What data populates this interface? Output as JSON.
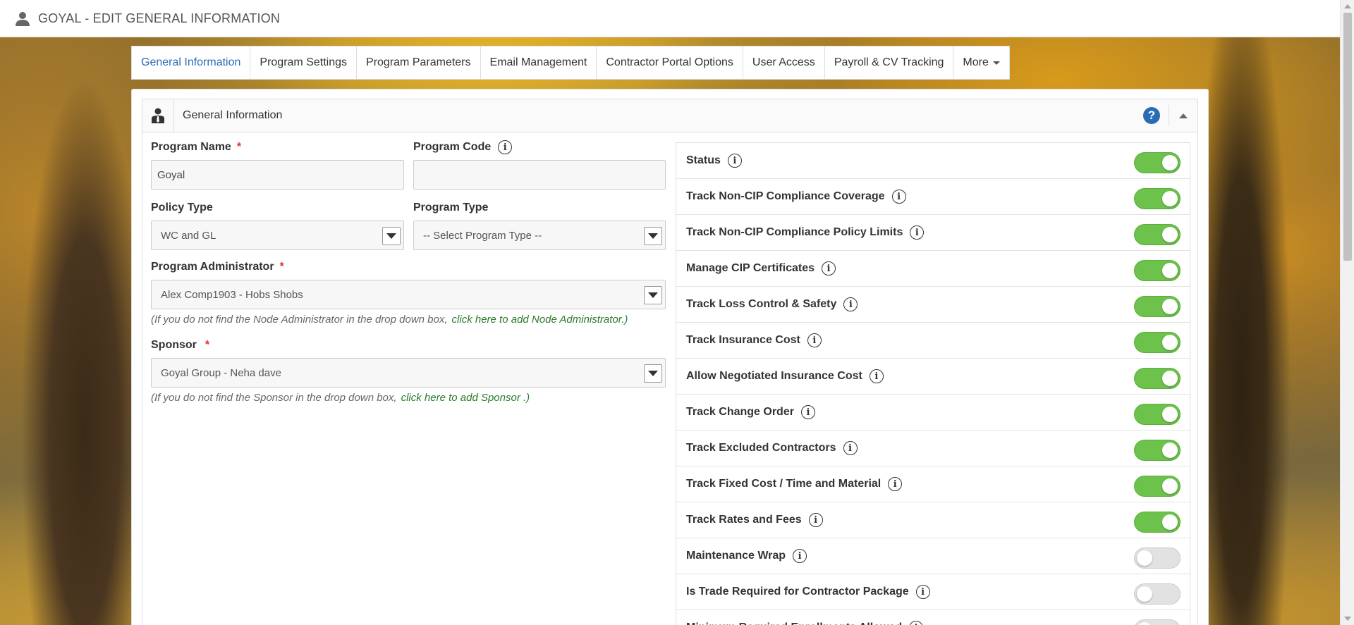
{
  "header": {
    "title": "GOYAL - EDIT GENERAL INFORMATION"
  },
  "tabs": [
    {
      "label": "General Information",
      "active": true
    },
    {
      "label": "Program Settings"
    },
    {
      "label": "Program Parameters"
    },
    {
      "label": "Email Management"
    },
    {
      "label": "Contractor Portal Options"
    },
    {
      "label": "User Access"
    },
    {
      "label": "Payroll & CV Tracking"
    },
    {
      "label": "More"
    }
  ],
  "panel": {
    "title": "General Information",
    "help": "?"
  },
  "form": {
    "program_name": {
      "label": "Program Name",
      "required": "*",
      "value": "Goyal"
    },
    "program_code": {
      "label": "Program Code",
      "value": ""
    },
    "policy_type": {
      "label": "Policy Type",
      "value": "WC and GL"
    },
    "program_type": {
      "label": "Program Type",
      "value": "-- Select Program Type --"
    },
    "program_admin": {
      "label": "Program Administrator",
      "required": "*",
      "value": "Alex Comp1903 - Hobs Shobs",
      "hint": "(If you do not find the Node Administrator in the drop down box,",
      "hint_link": "click here to add Node Administrator.)"
    },
    "sponsor": {
      "label": "Sponsor",
      "required": "*",
      "value": "Goyal Group - Neha dave",
      "hint": "(If you do not find the Sponsor in the drop down box,",
      "hint_link": "click here to add Sponsor .)"
    }
  },
  "toggles": [
    {
      "label": "Status",
      "on": true
    },
    {
      "label": "Track Non-CIP Compliance Coverage",
      "on": true
    },
    {
      "label": "Track Non-CIP Compliance Policy Limits",
      "on": true
    },
    {
      "label": "Manage CIP Certificates",
      "on": true
    },
    {
      "label": "Track Loss Control & Safety",
      "on": true
    },
    {
      "label": "Track Insurance Cost",
      "on": true
    },
    {
      "label": "Allow Negotiated Insurance Cost",
      "on": true
    },
    {
      "label": "Track Change Order",
      "on": true
    },
    {
      "label": "Track Excluded Contractors",
      "on": true
    },
    {
      "label": "Track Fixed Cost / Time and Material",
      "on": true
    },
    {
      "label": "Track Rates and Fees",
      "on": true
    },
    {
      "label": "Maintenance Wrap",
      "on": false
    },
    {
      "label": "Is Trade Required for Contractor Package",
      "on": false
    },
    {
      "label": "Minimum Required Enrollments Allowed",
      "on": false
    }
  ],
  "colors": {
    "accent": "#2a6bb5",
    "toggle_on": "#6cc24a",
    "required": "#d9302b",
    "link": "#2b7a2b"
  }
}
